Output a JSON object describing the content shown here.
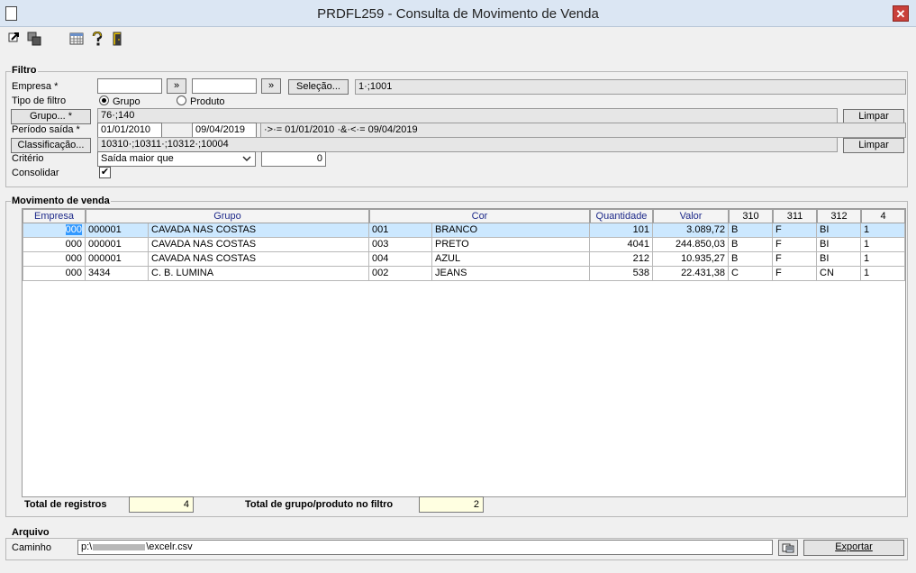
{
  "window": {
    "title": "PRDFL259 - Consulta de Movimento de Venda",
    "close_label": "✕"
  },
  "toolbar": {
    "icons": [
      "export-icon",
      "copy-icon",
      "calendar-grid-icon",
      "help-icon",
      "exit-door-icon"
    ]
  },
  "filtro": {
    "title": "Filtro",
    "empresa_label": "Empresa *",
    "empresa_value": "",
    "empresa_arrow": "»",
    "empresa2_value": "",
    "empresa2_arrow": "»",
    "selecao_label": "Seleção...",
    "selecao_value": "1·;1001",
    "tipo_label": "Tipo de filtro",
    "tipo_grupo": "Grupo",
    "tipo_produto": "Produto",
    "grupo_label": "Grupo... *",
    "grupo_value": "76·;140",
    "limpar1": "Limpar",
    "periodo_label": "Período saída *",
    "periodo_start": "01/01/2010",
    "periodo_end": "09/04/2019",
    "periodo_expr": "·>·= 01/01/2010 ·&·<·= 09/04/2019",
    "classificacao_label": "Classificação...",
    "classificacao_value": "10310·;10311·;10312·;10004",
    "limpar2": "Limpar",
    "criterio_label": "Critério",
    "criterio_value": "Saída maior que",
    "criterio_number": "0",
    "consolidar_label": "Consolidar",
    "consolidar_checked": "✔"
  },
  "movimento": {
    "title": "Movimento de venda",
    "headers": [
      "Empresa",
      "Grupo",
      "Cor",
      "Quantidade",
      "Valor",
      "310",
      "311",
      "312",
      "4"
    ],
    "rows": [
      {
        "empresa": "000",
        "grupo_cod": "000001",
        "grupo_desc": "CAVADA NAS COSTAS",
        "cor_cod": "001",
        "cor_desc": "BRANCO",
        "quantidade": "101",
        "valor": "3.089,72",
        "c310": "B",
        "c311": "F",
        "c312": "BI",
        "c4": "1"
      },
      {
        "empresa": "000",
        "grupo_cod": "000001",
        "grupo_desc": "CAVADA NAS COSTAS",
        "cor_cod": "003",
        "cor_desc": "PRETO",
        "quantidade": "4041",
        "valor": "244.850,03",
        "c310": "B",
        "c311": "F",
        "c312": "BI",
        "c4": "1"
      },
      {
        "empresa": "000",
        "grupo_cod": "000001",
        "grupo_desc": "CAVADA NAS COSTAS",
        "cor_cod": "004",
        "cor_desc": "AZUL",
        "quantidade": "212",
        "valor": "10.935,27",
        "c310": "B",
        "c311": "F",
        "c312": "BI",
        "c4": "1"
      },
      {
        "empresa": "000",
        "grupo_cod": "3434",
        "grupo_desc": "C. B. LUMINA",
        "cor_cod": "002",
        "cor_desc": "JEANS",
        "quantidade": "538",
        "valor": "22.431,38",
        "c310": "C",
        "c311": "F",
        "c312": "CN",
        "c4": "1"
      }
    ],
    "total_registros_label": "Total de registros",
    "total_registros_value": "4",
    "total_grupo_label": "Total de grupo/produto no filtro",
    "total_grupo_value": "2"
  },
  "arquivo": {
    "title": "Arquivo",
    "caminho_label": "Caminho",
    "caminho_prefix": "p:\\",
    "caminho_suffix": "\\excelr.csv",
    "exportar_label": "Exportar"
  }
}
